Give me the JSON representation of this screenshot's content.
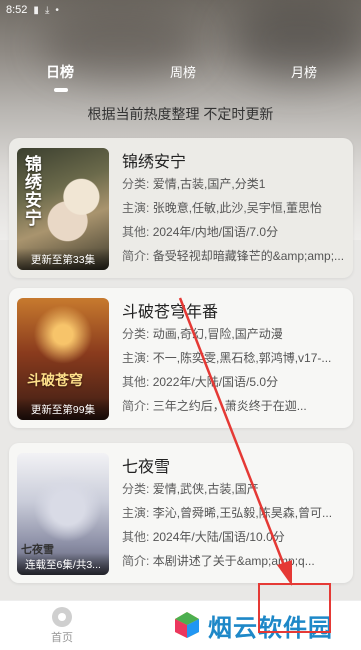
{
  "status_bar": {
    "time": "8:52",
    "icons": [
      "sim-icon",
      "download-icon",
      "dot-icon"
    ]
  },
  "tabs": [
    {
      "label": "日榜",
      "active": true
    },
    {
      "label": "周榜",
      "active": false
    },
    {
      "label": "月榜",
      "active": false
    }
  ],
  "subtitle": "根据当前热度整理 不定时更新",
  "cards": [
    {
      "title": "锦绣安宁",
      "poster_badge": "更新至第33集",
      "poster_art_text": "锦绣安宁",
      "category_label": "分类:",
      "category": "爱情,古装,国产,分类1",
      "cast_label": "主演:",
      "cast": "张晚意,任敏,此沙,吴宇恒,董思怡",
      "other_label": "其他:",
      "other": "2024年/内地/国语/7.0分",
      "intro_label": "简介:",
      "intro": "备受轻视却暗藏锋芒的&amp;amp;..."
    },
    {
      "title": "斗破苍穹年番",
      "poster_badge": "更新至第99集",
      "poster_art_text": "斗破苍穹",
      "category_label": "分类:",
      "category": "动画,奇幻,冒险,国产动漫",
      "cast_label": "主演:",
      "cast": "不一,陈奕雯,黑石稔,郭鸿博,v17-...",
      "other_label": "其他:",
      "other": "2022年/大陆/国语/5.0分",
      "intro_label": "简介:",
      "intro": "  三年之约后，萧炎终于在迦..."
    },
    {
      "title": "七夜雪",
      "poster_badge": "连载至6集/共3...",
      "poster_art_text": "七夜雪",
      "category_label": "分类:",
      "category": "爱情,武侠,古装,国产",
      "cast_label": "主演:",
      "cast": "李沁,曾舜晞,王弘毅,陈昊森,曾可...",
      "other_label": "其他:",
      "other": "2024年/大陆/国语/10.0分",
      "intro_label": "简介:",
      "intro": "  本剧讲述了关于&amp;amp;q..."
    }
  ],
  "bottom_nav": {
    "home_label": "首页"
  },
  "watermark": {
    "text": "烟云软件园"
  },
  "colors": {
    "annotation_red": "#e53935",
    "watermark_blue": "#1e88c8"
  }
}
